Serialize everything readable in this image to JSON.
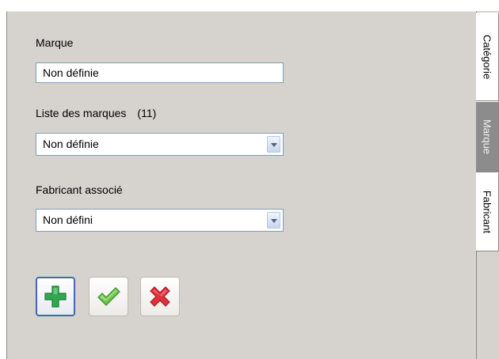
{
  "form": {
    "marque_label": "Marque",
    "marque_value": "Non définie",
    "liste_label": "Liste des marques",
    "liste_count": "(11)",
    "liste_selected": "Non définie",
    "fabricant_label": "Fabricant associé",
    "fabricant_selected": "Non défini"
  },
  "actions": {
    "add_icon": "green-plus-icon",
    "validate_icon": "green-checkmark-icon",
    "cancel_icon": "red-x-icon"
  },
  "tabs": [
    {
      "label": "Catégorie",
      "active": false
    },
    {
      "label": "Marque",
      "active": true
    },
    {
      "label": "Fabricant",
      "active": false
    }
  ],
  "colors": {
    "panel_bg": "#d6d3ce",
    "active_tab_bg": "#8c8c8c",
    "input_border": "#7f9db9",
    "add_green": "#2fa84f",
    "cancel_red": "#e0303a"
  }
}
